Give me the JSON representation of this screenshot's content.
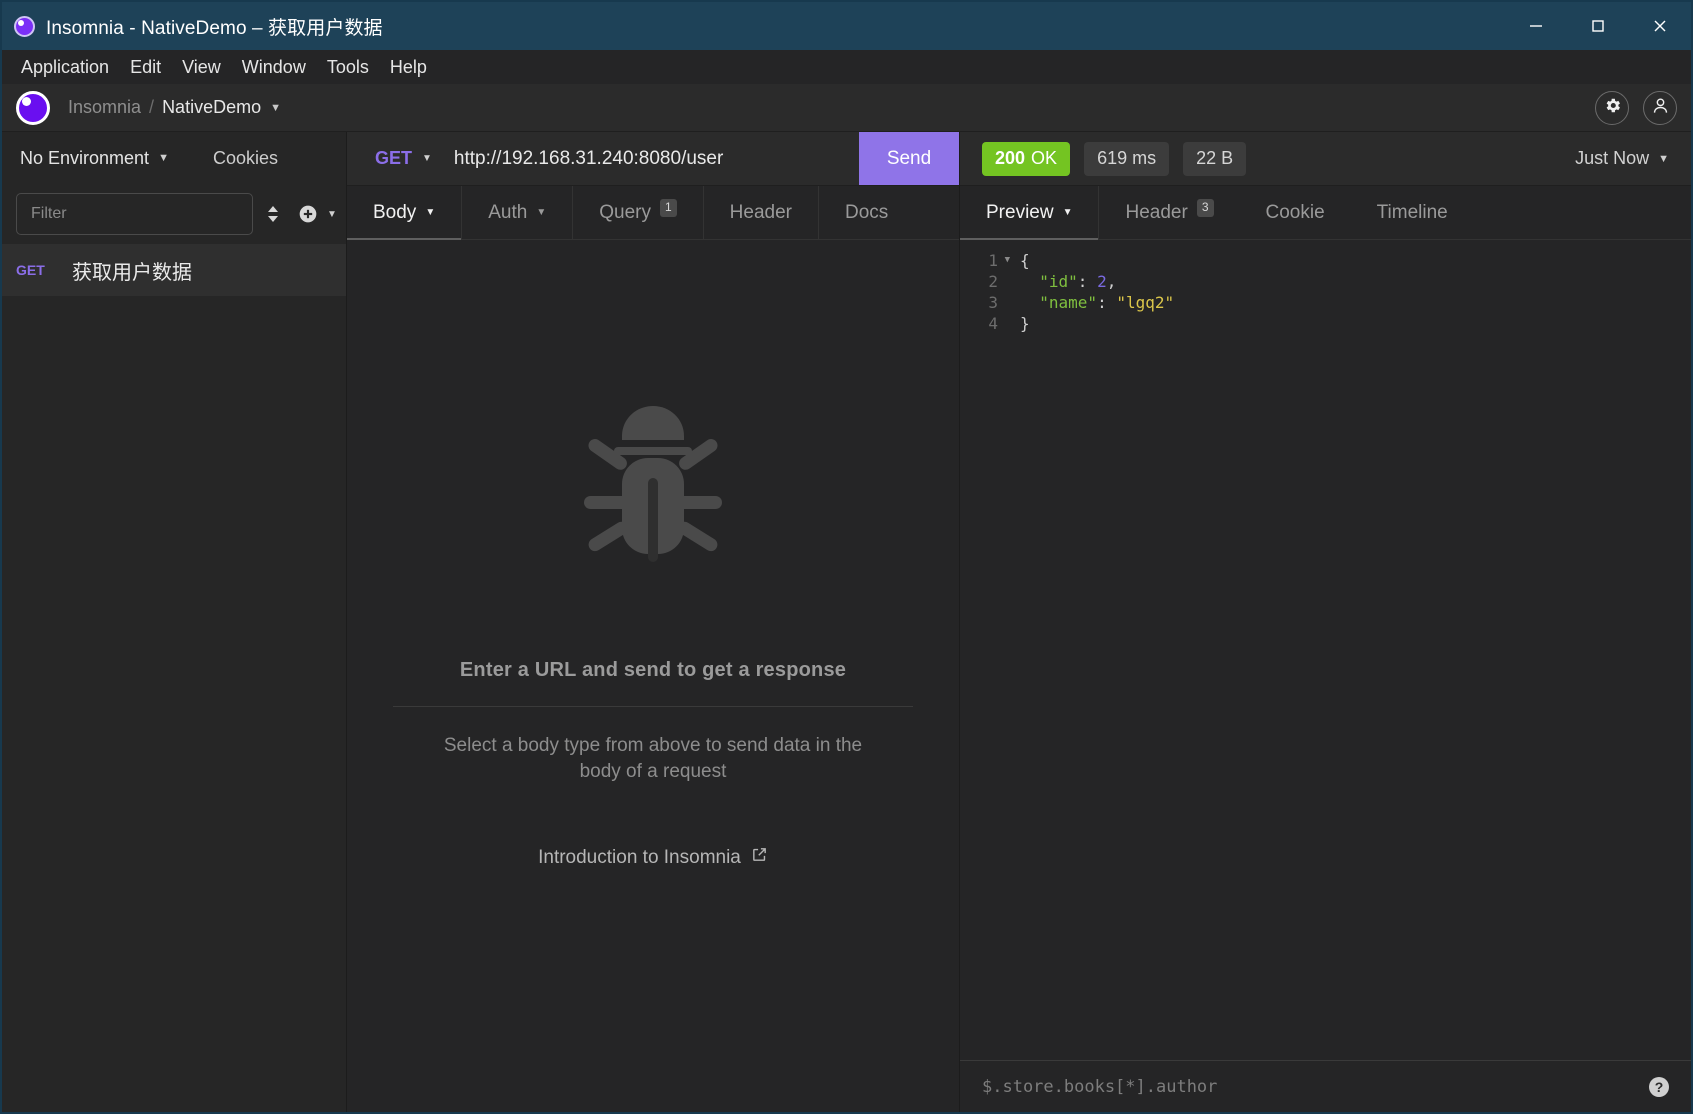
{
  "window": {
    "title": "Insomnia - NativeDemo – 获取用户数据",
    "minimize_label": "Minimize",
    "maximize_label": "Maximize",
    "close_label": "Close"
  },
  "menubar": {
    "items": [
      {
        "label": "Application"
      },
      {
        "label": "Edit"
      },
      {
        "label": "View"
      },
      {
        "label": "Window"
      },
      {
        "label": "Tools"
      },
      {
        "label": "Help"
      }
    ]
  },
  "header": {
    "breadcrumb_root": "Insomnia",
    "breadcrumb_sep": "/",
    "breadcrumb_current": "NativeDemo",
    "breadcrumb_caret": "▼",
    "settings_icon": "gear-icon",
    "account_icon": "user-icon"
  },
  "sidebar": {
    "environment": "No Environment",
    "environment_caret": "▼",
    "cookies_label": "Cookies",
    "filter_placeholder": "Filter",
    "filter_value": "",
    "sort_icon": "sort-icon",
    "add_icon": "plus-circle-icon",
    "add_caret": "▼",
    "requests": [
      {
        "method": "GET",
        "name": "获取用户数据"
      }
    ]
  },
  "request": {
    "method": "GET",
    "method_caret": "▼",
    "url": "http://192.168.31.240:8080/user",
    "url_placeholder": "Enter a URL",
    "send_label": "Send",
    "tabs": [
      {
        "label": "Body",
        "caret": "▼",
        "badge": "",
        "active": true
      },
      {
        "label": "Auth",
        "caret": "▼",
        "badge": "",
        "active": false
      },
      {
        "label": "Query",
        "caret": "",
        "badge": "1",
        "active": false
      },
      {
        "label": "Header",
        "caret": "",
        "badge": "",
        "active": false
      },
      {
        "label": "Docs",
        "caret": "",
        "badge": "",
        "active": false
      }
    ],
    "empty_state": {
      "icon": "bug-icon",
      "heading": "Enter a URL and send to get a response",
      "subtext": "Select a body type from above to send data in the body of a request",
      "link_label": "Introduction to Insomnia",
      "link_icon": "external-link-icon"
    }
  },
  "response": {
    "status_code": "200",
    "status_text": "OK",
    "time": "619 ms",
    "size": "22 B",
    "timestamp": "Just Now",
    "timestamp_caret": "▼",
    "tabs": [
      {
        "label": "Preview",
        "caret": "▼",
        "badge": "",
        "active": true
      },
      {
        "label": "Header",
        "caret": "",
        "badge": "3",
        "active": false
      },
      {
        "label": "Cookie",
        "caret": "",
        "badge": "",
        "active": false
      },
      {
        "label": "Timeline",
        "caret": "",
        "badge": "",
        "active": false
      }
    ],
    "body_lines": [
      {
        "n": "1",
        "fold": "▼",
        "segments": [
          {
            "t": "{",
            "c": "j-pun"
          }
        ]
      },
      {
        "n": "2",
        "fold": "",
        "segments": [
          {
            "t": "  \"id\"",
            "c": "j-key"
          },
          {
            "t": ": ",
            "c": "j-pun"
          },
          {
            "t": "2",
            "c": "j-num"
          },
          {
            "t": ",",
            "c": "j-pun"
          }
        ]
      },
      {
        "n": "3",
        "fold": "",
        "segments": [
          {
            "t": "  \"name\"",
            "c": "j-key"
          },
          {
            "t": ": ",
            "c": "j-pun"
          },
          {
            "t": "\"lgq2\"",
            "c": "j-str"
          }
        ]
      },
      {
        "n": "4",
        "fold": "",
        "segments": [
          {
            "t": "}",
            "c": "j-pun"
          }
        ]
      }
    ],
    "filter_placeholder": "$.store.books[*].author",
    "filter_value": "",
    "help_icon": "question-mark-icon",
    "help_glyph": "?"
  },
  "colors": {
    "titlebar": "#1e4258",
    "accent_purple": "#8f74e8",
    "status_green": "#74c422",
    "method_purple": "#8b6ee8"
  }
}
